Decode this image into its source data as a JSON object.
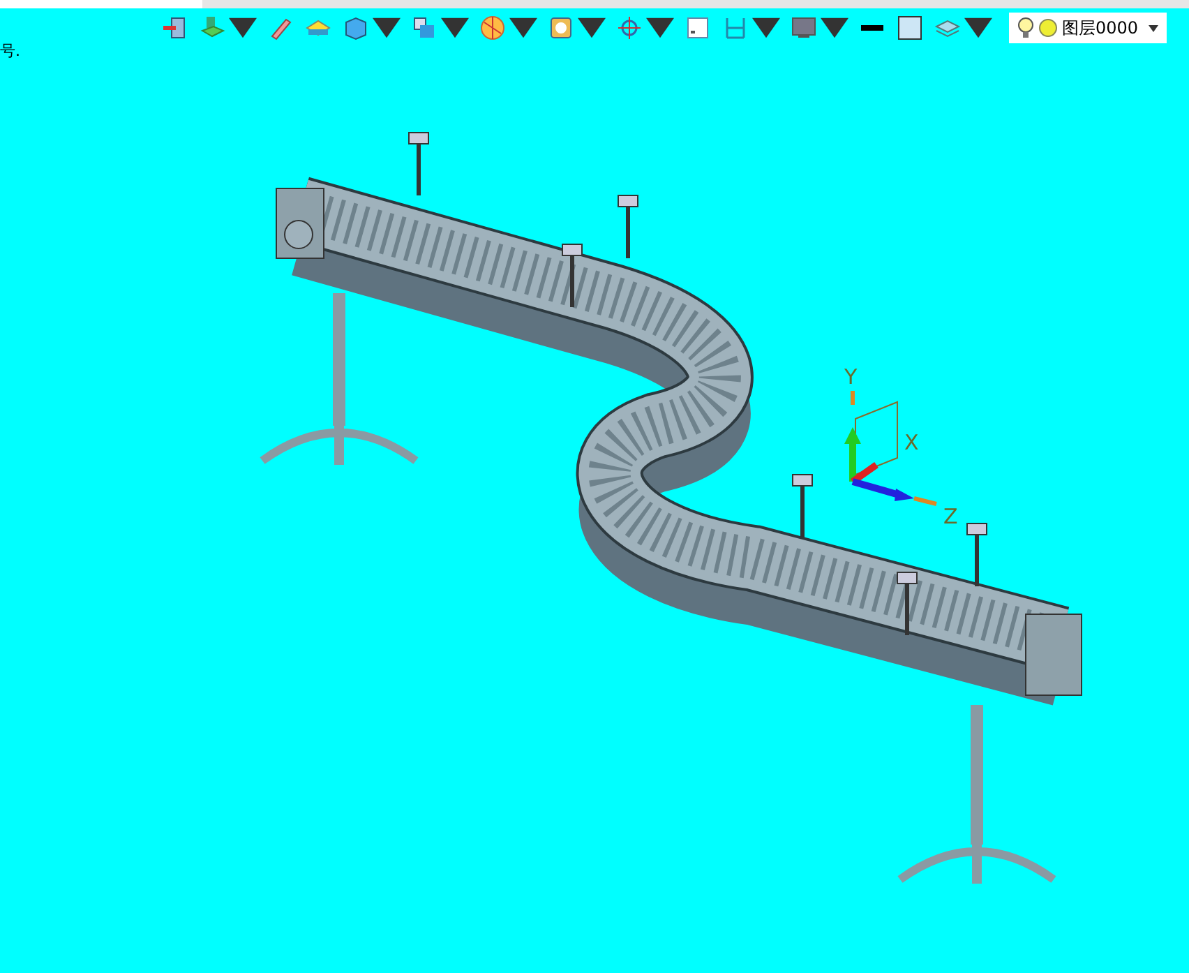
{
  "caption_fragment": "号.",
  "toolbar": [
    {
      "kind": "exit",
      "has_menu": false
    },
    {
      "kind": "layers",
      "has_menu": true
    },
    {
      "kind": "pencil",
      "has_menu": false
    },
    {
      "kind": "plane",
      "has_menu": false
    },
    {
      "kind": "cube",
      "has_menu": true
    },
    {
      "kind": "view",
      "has_menu": true
    },
    {
      "kind": "sphere",
      "has_menu": true
    },
    {
      "kind": "render",
      "has_menu": true
    },
    {
      "kind": "snap",
      "has_menu": true
    },
    {
      "kind": "frame",
      "has_menu": false
    },
    {
      "kind": "section",
      "has_menu": true
    },
    {
      "kind": "display",
      "has_menu": true
    },
    {
      "kind": "line",
      "has_menu": false
    },
    {
      "kind": "fill",
      "has_menu": false
    },
    {
      "kind": "stack",
      "has_menu": true
    }
  ],
  "layer_selector": {
    "name": "图层0000",
    "visible": true
  },
  "axes": {
    "x": "X",
    "y": "Y",
    "z": "Z"
  }
}
